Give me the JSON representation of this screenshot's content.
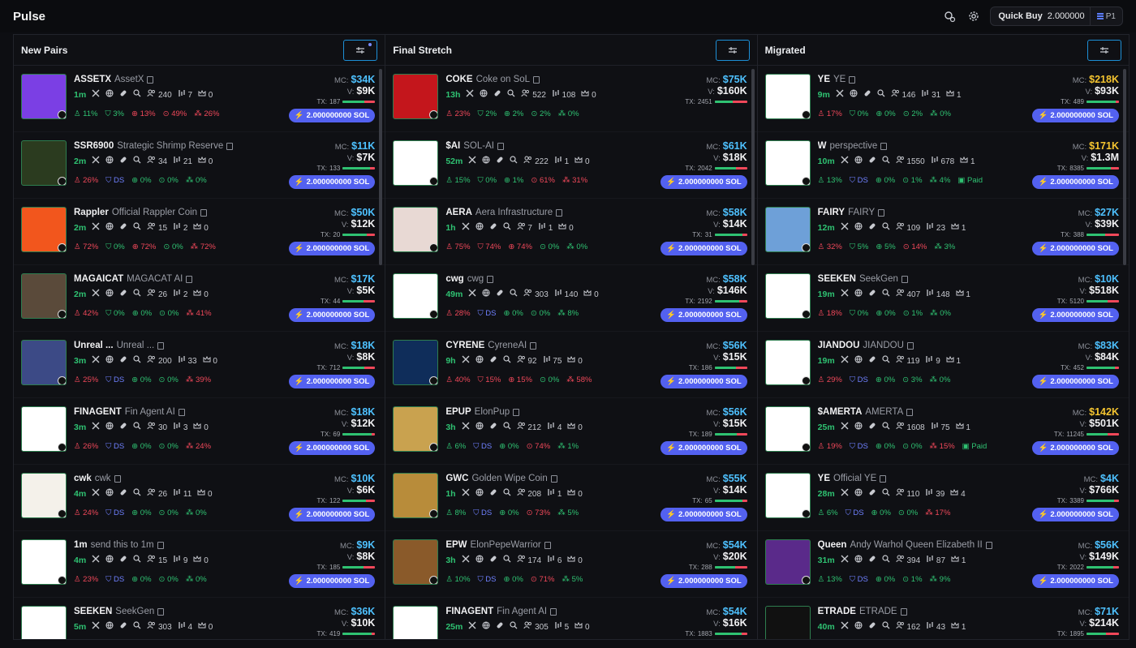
{
  "app": {
    "title": "Pulse"
  },
  "topbar": {
    "quick_buy_label": "Quick Buy",
    "quick_buy_value": "2.000000",
    "preset": "P1"
  },
  "columns": [
    {
      "title": "New Pairs",
      "rows": [
        {
          "ticker": "ASSETX",
          "name": "AssetX",
          "age": "1m",
          "holders": "240",
          "pro": "7",
          "ins": "0",
          "stats": [
            "11%",
            "3%",
            "13%",
            "49%",
            "26%"
          ],
          "mc": "$34K",
          "vol": "$9K",
          "tx": "187",
          "buy": "2.000000000 SOL",
          "thumb": "#7b3fe4"
        },
        {
          "ticker": "SSR6900",
          "name": "Strategic Shrimp Reserve",
          "age": "2m",
          "holders": "34",
          "pro": "21",
          "ins": "0",
          "stats": [
            "26%",
            "DS",
            "0%",
            "0%",
            "0%"
          ],
          "mc": "$11K",
          "vol": "$7K",
          "tx": "133",
          "buy": "2.000000000 SOL",
          "thumb": "#2b3b1f"
        },
        {
          "ticker": "Rappler",
          "name": "Official Rappler Coin",
          "age": "2m",
          "holders": "15",
          "pro": "2",
          "ins": "0",
          "stats": [
            "72%",
            "0%",
            "72%",
            "0%",
            "72%"
          ],
          "mc": "$50K",
          "vol": "$12K",
          "tx": "20",
          "buy": "2.000000000 SOL",
          "thumb": "#f2561d"
        },
        {
          "ticker": "MAGAICAT",
          "name": "MAGACAT AI",
          "age": "2m",
          "holders": "26",
          "pro": "2",
          "ins": "0",
          "stats": [
            "42%",
            "0%",
            "0%",
            "0%",
            "41%"
          ],
          "mc": "$17K",
          "vol": "$5K",
          "tx": "44",
          "buy": "2.000000000 SOL",
          "thumb": "#5a4a3a"
        },
        {
          "ticker": "Unreal ...",
          "name": "Unreal ...",
          "age": "3m",
          "holders": "200",
          "pro": "33",
          "ins": "0",
          "stats": [
            "25%",
            "DS",
            "0%",
            "0%",
            "39%"
          ],
          "mc": "$18K",
          "vol": "$8K",
          "tx": "712",
          "buy": "2.000000000 SOL",
          "thumb": "#3c4a86"
        },
        {
          "ticker": "FINAGENT",
          "name": "Fin Agent AI",
          "age": "3m",
          "holders": "30",
          "pro": "3",
          "ins": "0",
          "stats": [
            "26%",
            "DS",
            "0%",
            "0%",
            "24%"
          ],
          "mc": "$18K",
          "vol": "$12K",
          "tx": "69",
          "buy": "2.000000000 SOL",
          "thumb": "#ffffff"
        },
        {
          "ticker": "cwk",
          "name": "cwk",
          "age": "4m",
          "holders": "26",
          "pro": "11",
          "ins": "0",
          "stats": [
            "24%",
            "DS",
            "0%",
            "0%",
            "0%"
          ],
          "mc": "$10K",
          "vol": "$6K",
          "tx": "122",
          "buy": "2.000000000 SOL",
          "thumb": "#f4f1ea"
        },
        {
          "ticker": "1m",
          "name": "send this to 1m",
          "age": "4m",
          "holders": "15",
          "pro": "9",
          "ins": "0",
          "stats": [
            "23%",
            "DS",
            "0%",
            "0%",
            "0%"
          ],
          "mc": "$9K",
          "vol": "$8K",
          "tx": "185",
          "buy": "2.000000000 SOL",
          "thumb": "#ffffff"
        },
        {
          "ticker": "SEEKEN",
          "name": "SeekGen",
          "age": "5m",
          "holders": "303",
          "pro": "4",
          "ins": "0",
          "stats": [],
          "mc": "$36K",
          "vol": "$10K",
          "tx": "419",
          "buy": "",
          "thumb": "#ffffff"
        }
      ]
    },
    {
      "title": "Final Stretch",
      "rows": [
        {
          "ticker": "COKE",
          "name": "Coke on SoL",
          "age": "13h",
          "holders": "522",
          "pro": "108",
          "ins": "0",
          "stats": [
            "23%",
            "2%",
            "2%",
            "2%",
            "0%"
          ],
          "mc": "$75K",
          "vol": "$160K",
          "tx": "2451",
          "buy": "",
          "thumb": "#c4161c"
        },
        {
          "ticker": "$AI",
          "name": "SOL-AI",
          "age": "52m",
          "holders": "222",
          "pro": "1",
          "ins": "0",
          "stats": [
            "15%",
            "0%",
            "1%",
            "61%",
            "31%"
          ],
          "mc": "$61K",
          "vol": "$18K",
          "tx": "2042",
          "buy": "2.000000000 SOL",
          "thumb": "#ffffff"
        },
        {
          "ticker": "AERA",
          "name": "Aera Infrastructure",
          "age": "1h",
          "holders": "7",
          "pro": "1",
          "ins": "0",
          "stats": [
            "75%",
            "74%",
            "74%",
            "0%",
            "0%"
          ],
          "mc": "$58K",
          "vol": "$14K",
          "tx": "31",
          "buy": "2.000000000 SOL",
          "thumb": "#e8d9d4"
        },
        {
          "ticker": "cwg",
          "name": "cwg",
          "age": "49m",
          "holders": "303",
          "pro": "140",
          "ins": "0",
          "stats": [
            "28%",
            "DS",
            "0%",
            "0%",
            "8%"
          ],
          "mc": "$58K",
          "vol": "$146K",
          "tx": "2192",
          "buy": "2.000000000 SOL",
          "thumb": "#ffffff"
        },
        {
          "ticker": "CYRENE",
          "name": "CyreneAI",
          "age": "9h",
          "holders": "92",
          "pro": "75",
          "ins": "0",
          "stats": [
            "40%",
            "15%",
            "15%",
            "0%",
            "58%"
          ],
          "mc": "$56K",
          "vol": "$15K",
          "tx": "186",
          "buy": "2.000000000 SOL",
          "thumb": "#0f2d5a"
        },
        {
          "ticker": "EPUP",
          "name": "ElonPup",
          "age": "3h",
          "holders": "212",
          "pro": "4",
          "ins": "0",
          "stats": [
            "6%",
            "DS",
            "0%",
            "74%",
            "1%"
          ],
          "mc": "$56K",
          "vol": "$15K",
          "tx": "189",
          "buy": "2.000000000 SOL",
          "thumb": "#c9a24f"
        },
        {
          "ticker": "GWC",
          "name": "Golden Wipe Coin",
          "age": "1h",
          "holders": "208",
          "pro": "1",
          "ins": "0",
          "stats": [
            "8%",
            "DS",
            "0%",
            "73%",
            "5%"
          ],
          "mc": "$55K",
          "vol": "$14K",
          "tx": "65",
          "buy": "2.000000000 SOL",
          "thumb": "#b88c3a"
        },
        {
          "ticker": "EPW",
          "name": "ElonPepeWarrior",
          "age": "3h",
          "holders": "174",
          "pro": "6",
          "ins": "0",
          "stats": [
            "10%",
            "DS",
            "0%",
            "71%",
            "5%"
          ],
          "mc": "$54K",
          "vol": "$20K",
          "tx": "288",
          "buy": "2.000000000 SOL",
          "thumb": "#8a5a2a"
        },
        {
          "ticker": "FINAGENT",
          "name": "Fin Agent AI",
          "age": "25m",
          "holders": "305",
          "pro": "5",
          "ins": "0",
          "stats": [],
          "mc": "$54K",
          "vol": "$16K",
          "tx": "1883",
          "buy": "",
          "thumb": "#ffffff"
        }
      ]
    },
    {
      "title": "Migrated",
      "rows": [
        {
          "ticker": "YE",
          "name": "YE",
          "age": "9m",
          "holders": "146",
          "pro": "31",
          "ins": "1",
          "stats": [
            "17%",
            "0%",
            "0%",
            "2%",
            "0%"
          ],
          "mc": "$218K",
          "vol": "$93K",
          "tx": "489",
          "buy": "2.000000000 SOL",
          "thumb": "#ffffff"
        },
        {
          "ticker": "W",
          "name": "perspective",
          "age": "10m",
          "holders": "1550",
          "pro": "678",
          "ins": "1",
          "stats": [
            "13%",
            "DS",
            "0%",
            "1%",
            "4%"
          ],
          "mc": "$171K",
          "vol": "$1.3M",
          "tx": "8385",
          "buy": "2.000000000 SOL",
          "thumb": "#ffffff",
          "paid": "Paid"
        },
        {
          "ticker": "FAIRY",
          "name": "FAIRY",
          "age": "12m",
          "holders": "109",
          "pro": "23",
          "ins": "1",
          "stats": [
            "32%",
            "5%",
            "5%",
            "14%",
            "3%"
          ],
          "mc": "$27K",
          "vol": "$39K",
          "tx": "388",
          "buy": "2.000000000 SOL",
          "thumb": "#6ea0d8"
        },
        {
          "ticker": "SEEKEN",
          "name": "SeekGen",
          "age": "19m",
          "holders": "407",
          "pro": "148",
          "ins": "1",
          "stats": [
            "18%",
            "0%",
            "0%",
            "1%",
            "0%"
          ],
          "mc": "$10K",
          "vol": "$518K",
          "tx": "5120",
          "buy": "2.000000000 SOL",
          "thumb": "#ffffff"
        },
        {
          "ticker": "JIANDOU",
          "name": "JIANDOU",
          "age": "19m",
          "holders": "119",
          "pro": "9",
          "ins": "1",
          "stats": [
            "29%",
            "DS",
            "0%",
            "3%",
            "0%"
          ],
          "mc": "$83K",
          "vol": "$84K",
          "tx": "452",
          "buy": "2.000000000 SOL",
          "thumb": "#ffffff"
        },
        {
          "ticker": "$AMERTA",
          "name": "AMERTA",
          "age": "25m",
          "holders": "1608",
          "pro": "75",
          "ins": "1",
          "stats": [
            "19%",
            "DS",
            "0%",
            "0%",
            "15%"
          ],
          "mc": "$142K",
          "vol": "$501K",
          "tx": "11245",
          "buy": "2.000000000 SOL",
          "thumb": "#ffffff",
          "paid": "Paid"
        },
        {
          "ticker": "YE",
          "name": "Official YE",
          "age": "28m",
          "holders": "110",
          "pro": "39",
          "ins": "4",
          "stats": [
            "6%",
            "DS",
            "0%",
            "0%",
            "17%"
          ],
          "mc": "$4K",
          "vol": "$766K",
          "tx": "3389",
          "buy": "2.000000000 SOL",
          "thumb": "#ffffff"
        },
        {
          "ticker": "Queen",
          "name": "Andy Warhol Queen Elizabeth II",
          "age": "31m",
          "holders": "394",
          "pro": "87",
          "ins": "1",
          "stats": [
            "13%",
            "DS",
            "0%",
            "1%",
            "9%"
          ],
          "mc": "$56K",
          "vol": "$149K",
          "tx": "2022",
          "buy": "2.000000000 SOL",
          "thumb": "#5a2a8a"
        },
        {
          "ticker": "ETRADE",
          "name": "ETRADE",
          "age": "40m",
          "holders": "162",
          "pro": "43",
          "ins": "1",
          "stats": [],
          "mc": "$71K",
          "vol": "$214K",
          "tx": "1895",
          "buy": "",
          "thumb": "#111111"
        }
      ]
    }
  ],
  "labels": {
    "mc": "MC:",
    "vol": "V:",
    "tx": "TX:"
  },
  "colors": {
    "accent": "#5361f0",
    "green": "#2fc272",
    "red": "#f0485a",
    "mc_blue": "#4ec1ff",
    "mc_gold": "#f4c430"
  }
}
